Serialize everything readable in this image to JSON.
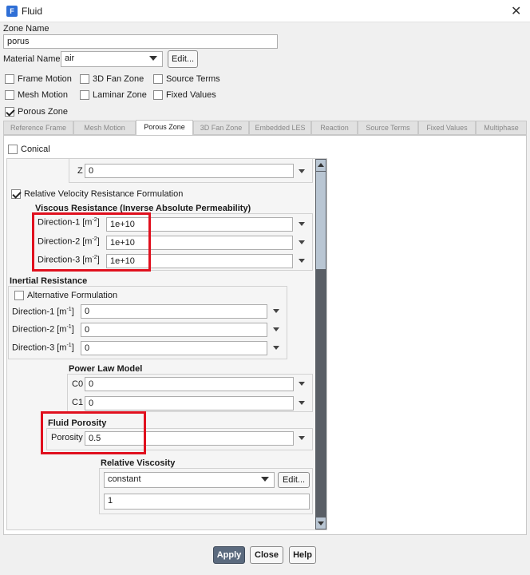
{
  "window": {
    "title": "Fluid",
    "app_icon_letter": "F"
  },
  "zone_name": {
    "label": "Zone Name",
    "value": "porus"
  },
  "material": {
    "label": "Material Name",
    "value": "air",
    "edit_label": "Edit..."
  },
  "options": {
    "frame_motion": "Frame Motion",
    "fan_zone": "3D Fan Zone",
    "source_terms": "Source Terms",
    "mesh_motion": "Mesh Motion",
    "laminar_zone": "Laminar Zone",
    "fixed_values": "Fixed Values",
    "porous_zone": "Porous Zone"
  },
  "tabs": [
    "Reference Frame",
    "Mesh Motion",
    "Porous Zone",
    "3D Fan Zone",
    "Embedded LES",
    "Reaction",
    "Source Terms",
    "Fixed Values",
    "Multiphase"
  ],
  "porous": {
    "conical": "Conical",
    "z_label": "Z",
    "z_value": "0",
    "relative_velocity": "Relative Velocity Resistance Formulation",
    "viscous": {
      "title": "Viscous Resistance (Inverse Absolute Permeability)",
      "d1": "Direction-1 [m",
      "d2": "Direction-2 [m",
      "d3": "Direction-3 [m",
      "exp": "-2",
      "close": "]",
      "v1": "1e+10",
      "v2": "1e+10",
      "v3": "1e+10"
    },
    "inertial": {
      "title": "Inertial Resistance",
      "alt": "Alternative Formulation",
      "d1": "Direction-1 [m",
      "d2": "Direction-2 [m",
      "d3": "Direction-3 [m",
      "exp": "-1",
      "close": "]",
      "v1": "0",
      "v2": "0",
      "v3": "0"
    },
    "power_law": {
      "title": "Power Law Model",
      "c0_label": "C0",
      "c0": "0",
      "c1_label": "C1",
      "c1": "0"
    },
    "fluid_porosity": {
      "title": "Fluid Porosity",
      "label": "Porosity",
      "value": "0.5"
    },
    "relative_viscosity": {
      "title": "Relative Viscosity",
      "method": "constant",
      "edit_label": "Edit...",
      "value": "1"
    }
  },
  "buttons": {
    "apply": "Apply",
    "close": "Close",
    "help": "Help"
  }
}
